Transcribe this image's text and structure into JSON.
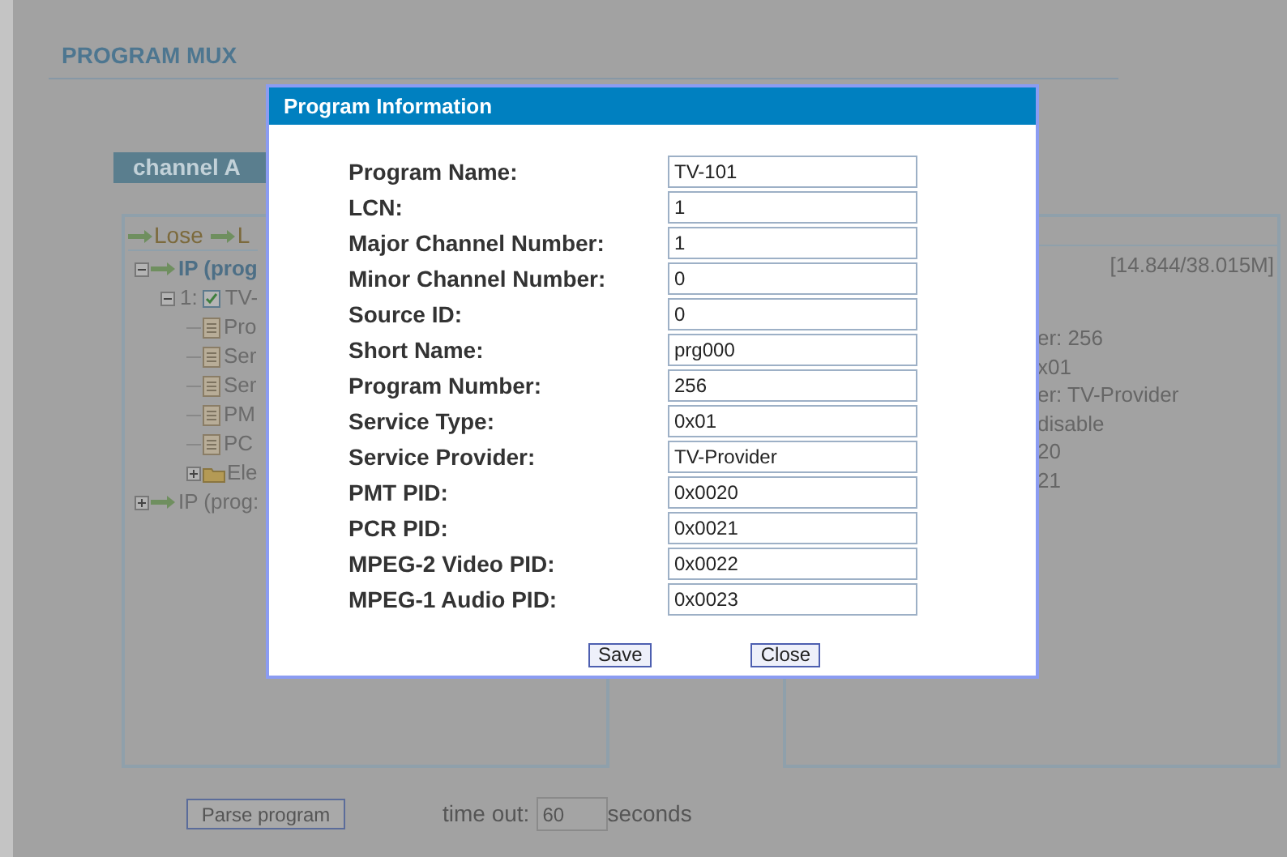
{
  "page": {
    "title": "PROGRAM MUX",
    "channel_tab": "channel A"
  },
  "left_panel": {
    "header": [
      {
        "label": "Lose"
      },
      {
        "label": "L"
      }
    ],
    "tree": [
      {
        "kind": "source",
        "label": "IP (prog",
        "expanded": true,
        "children": [
          {
            "kind": "program",
            "index": "1:",
            "label": "TV-",
            "checked": true,
            "expanded": true,
            "children": [
              {
                "kind": "file",
                "label": "Pro"
              },
              {
                "kind": "file",
                "label": "Ser"
              },
              {
                "kind": "file",
                "label": "Ser"
              },
              {
                "kind": "file",
                "label": "PM"
              },
              {
                "kind": "file",
                "label": "PC"
              },
              {
                "kind": "folder",
                "label": "Ele",
                "expanded": false
              }
            ]
          }
        ]
      },
      {
        "kind": "source",
        "label": "IP (prog:",
        "expanded": false
      }
    ]
  },
  "right_panel": {
    "rate": "[14.844/38.015M]",
    "lines": [
      "er: 256",
      "x01",
      "er: TV-Provider",
      "disable",
      "20",
      "21"
    ]
  },
  "bottom": {
    "parse_button": "Parse program",
    "timeout_label": "time out:",
    "timeout_value": "60",
    "timeout_unit": "seconds"
  },
  "dialog": {
    "title": "Program Information",
    "fields": [
      {
        "label": "Program Name:",
        "value": "TV-101"
      },
      {
        "label": "LCN:",
        "value": "1"
      },
      {
        "label": "Major Channel Number:",
        "value": "1"
      },
      {
        "label": "Minor Channel Number:",
        "value": "0"
      },
      {
        "label": "Source ID:",
        "value": "0"
      },
      {
        "label": "Short Name:",
        "value": "prg000"
      },
      {
        "label": "Program Number:",
        "value": "256"
      },
      {
        "label": "Service Type:",
        "value": "0x01"
      },
      {
        "label": "Service Provider:",
        "value": "TV-Provider"
      },
      {
        "label": "PMT PID:",
        "value": "0x0020"
      },
      {
        "label": "PCR PID:",
        "value": "0x0021"
      },
      {
        "label": "MPEG-2 Video PID:",
        "value": "0x0022"
      },
      {
        "label": "MPEG-1 Audio PID:",
        "value": "0x0023"
      }
    ],
    "buttons": [
      "Save",
      "Close"
    ]
  }
}
